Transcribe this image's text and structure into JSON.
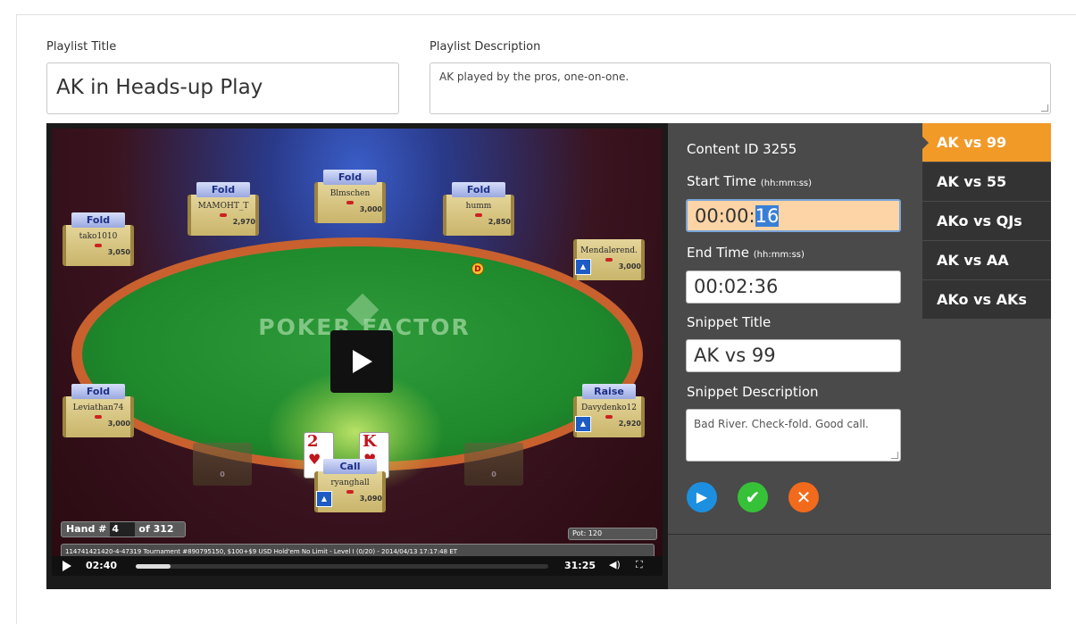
{
  "playlist": {
    "title_label": "Playlist Title",
    "title_value": "AK in Heads-up Play",
    "description_label": "Playlist Description",
    "description_value": "AK played by the pros, one-on-one."
  },
  "video": {
    "brand": "POKER FACTOR",
    "seats": [
      {
        "action": "Fold",
        "name": "tako1010",
        "stack": "3,050"
      },
      {
        "action": "Fold",
        "name": "MAMOHT_T",
        "stack": "2,970"
      },
      {
        "action": "Fold",
        "name": "Blmschen",
        "stack": "3,000"
      },
      {
        "action": "Fold",
        "name": "humm",
        "stack": "2,850"
      },
      {
        "action": "",
        "name": "Mendalerend.",
        "stack": "3,000"
      },
      {
        "action": "Fold",
        "name": "Leviathan74",
        "stack": "3,000"
      },
      {
        "action": "Raise",
        "name": "Davydenko12",
        "stack": "2,920"
      },
      {
        "action": "Call",
        "name": "ryanghall",
        "stack": "3,090"
      }
    ],
    "empty_seat_stack": "0",
    "dealer_button": "D",
    "hero_cards": [
      {
        "rank": "2",
        "suit": "♥",
        "color": "#c0161d"
      },
      {
        "rank": "K",
        "suit": "♥",
        "color": "#c0161d"
      }
    ],
    "hand_label": "Hand #",
    "hand_number": "4",
    "hand_total": "of 312",
    "pot": "Pot: 120",
    "info": "114741421420-4-47319 Tournament #890795150, $100+$9 USD Hold'em No Limit - Level I (0/20) - 2014/04/13 17:17:48 ET",
    "current_time": "02:40",
    "duration": "31:25",
    "progress_fraction": 0.085,
    "volume_icon": "volume-icon",
    "fullscreen_icon": "fullscreen-icon"
  },
  "editor": {
    "content_id": "Content ID 3255",
    "start_label": "Start Time",
    "start_hint": "(hh:mm:ss)",
    "start_value_prefix": "00:00:",
    "start_value_selected": "16",
    "end_label": "End Time",
    "end_hint": "(hh:mm:ss)",
    "end_value": "00:02:36",
    "snippet_title_label": "Snippet Title",
    "snippet_title_value": "AK vs 99",
    "snippet_desc_label": "Snippet Description",
    "snippet_desc_value": "Bad River. Check-fold. Good call.",
    "buttons": {
      "play": "▶",
      "confirm": "✔",
      "cancel": "✕"
    },
    "colors": {
      "play": "#1d8fe0",
      "confirm": "#37c138",
      "cancel": "#f26a1b"
    }
  },
  "snippets": [
    {
      "label": "AK vs 99",
      "active": true
    },
    {
      "label": "AK vs 55",
      "active": false
    },
    {
      "label": "AKo vs QJs",
      "active": false
    },
    {
      "label": "AK vs AA",
      "active": false
    },
    {
      "label": "AKo vs AKs",
      "active": false
    }
  ],
  "colors": {
    "accent": "#f19a28",
    "panel": "#4a4a4a"
  }
}
